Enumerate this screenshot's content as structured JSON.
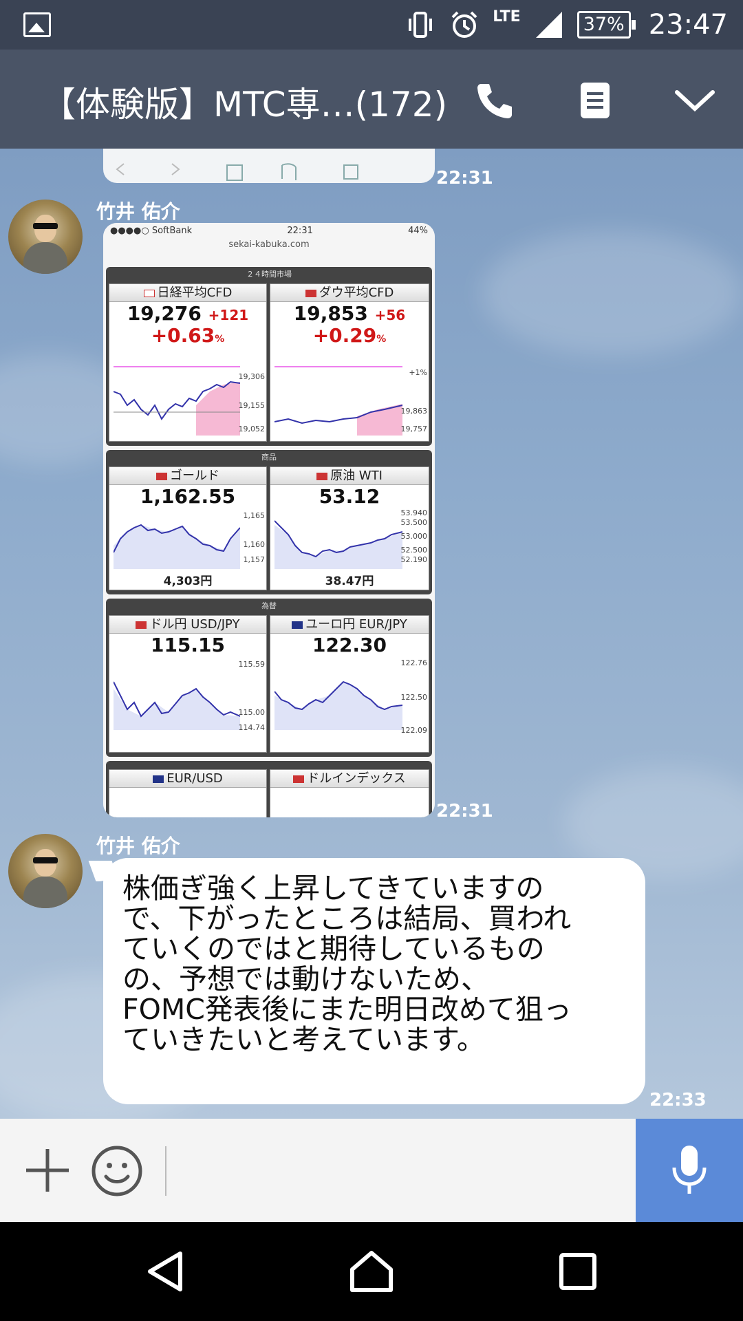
{
  "status_bar": {
    "network": "LTE",
    "battery": "37%",
    "time": "23:47"
  },
  "header": {
    "title": "【体験版】MTC専…(172)"
  },
  "messages": [
    {
      "type": "image",
      "time": "22:31"
    },
    {
      "type": "image",
      "sender": "竹井 佑介",
      "time": "22:31",
      "screenshot": {
        "status_left": "●●●●○ SoftBank",
        "status_time": "22:31",
        "status_right": "44%",
        "url": "sekai-kabuka.com",
        "sections": [
          {
            "title": "２４時間市場",
            "cells": [
              {
                "name": "日経平均CFD",
                "price": "19,276",
                "change": "+121",
                "pct": "+0.63",
                "pct_unit": "%",
                "axis": [
                  "19,306",
                  "19,155",
                  "19,052"
                ]
              },
              {
                "name": "ダウ平均CFD",
                "price": "19,853",
                "change": "+56",
                "pct": "+0.29",
                "pct_unit": "%",
                "axis": [
                  "+1%",
                  "19,863",
                  "19,757"
                ]
              }
            ]
          },
          {
            "title": "商品",
            "cells": [
              {
                "name": "ゴールド",
                "price": "1,162.55",
                "sub": "4,303円",
                "axis": [
                  "1,165",
                  "1,160",
                  "1,157"
                ]
              },
              {
                "name": "原油 WTI",
                "price": "53.12",
                "sub": "38.47円",
                "axis": [
                  "53.940",
                  "53.500",
                  "53.000",
                  "52.500",
                  "52.190"
                ]
              }
            ]
          },
          {
            "title": "為替",
            "cells": [
              {
                "name": "ドル円 USD/JPY",
                "price": "115.15",
                "axis": [
                  "115.59",
                  "115.00",
                  "114.74"
                ]
              },
              {
                "name": "ユーロ円 EUR/JPY",
                "price": "122.30",
                "axis": [
                  "122.76",
                  "122.50",
                  "122.09"
                ]
              }
            ]
          }
        ],
        "bottom_cells": [
          "EUR/USD",
          "ドルインデックス"
        ]
      }
    },
    {
      "type": "text",
      "sender": "竹井 佑介",
      "time": "22:33",
      "lines": [
        "株価ぎ強く上昇してきていますの",
        "で、下がったところは結局、買われ",
        "ていくのではと期待しているもの",
        "の、予想では動けないため、",
        "FOMC発表後にまた明日改めて狙っ",
        "ていきたいと考えています。"
      ]
    }
  ],
  "icons": {
    "call": "phone-icon",
    "notes": "notes-icon",
    "menu": "chevron-down-icon",
    "add": "plus-icon",
    "sticker": "emoji-icon",
    "voice": "mic-icon"
  },
  "colors": {
    "header": "#4a5466",
    "status_bar": "#3a4354",
    "mic_button": "#5b8ad8",
    "price_up": "#d01818"
  }
}
